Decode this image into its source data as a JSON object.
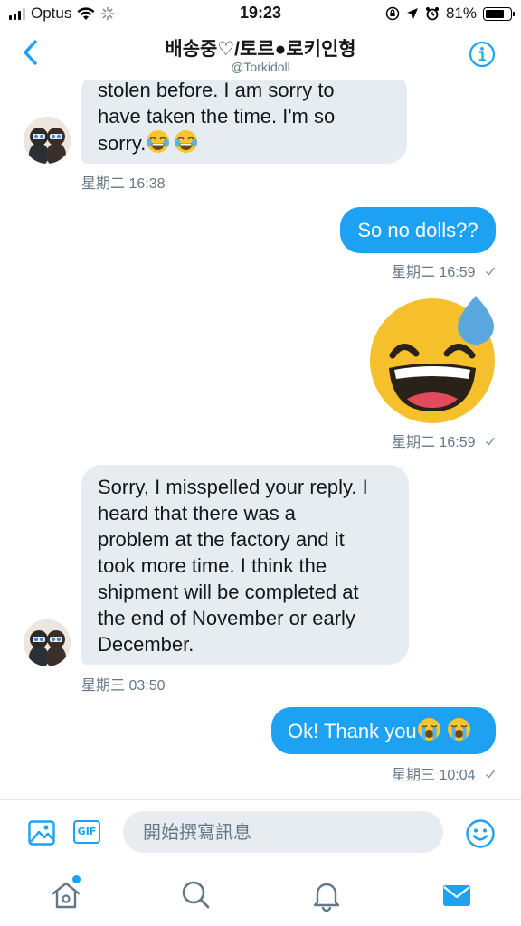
{
  "status_bar": {
    "carrier": "Optus",
    "time": "19:23",
    "battery_percent": "81%",
    "battery_level": 0.81,
    "icons": [
      "signal-icon",
      "wifi-icon",
      "loading-icon",
      "rotation-lock-icon",
      "location-icon",
      "alarm-icon",
      "battery-icon"
    ]
  },
  "header": {
    "title": "배송중♡/토르●로키인형",
    "handle": "@Torkidoll",
    "back_icon": "chevron-left-icon",
    "info_icon": "info-icon"
  },
  "conversation": {
    "contact_avatar_icon": "doll-avatar",
    "messages": [
      {
        "direction": "received",
        "text": "stolen before. I am sorry to have taken the time. I'm so sorry.",
        "emoji": [
          "face-with-tears-of-joy",
          "face-with-tears-of-joy"
        ],
        "timestamp": "星期二 16:38"
      },
      {
        "direction": "sent",
        "text": "So no dolls??",
        "timestamp": "星期二 16:59",
        "status_icon": "check-icon"
      },
      {
        "direction": "sent",
        "emoji_only": "grinning-face-with-sweat",
        "timestamp": "星期二 16:59",
        "status_icon": "check-icon"
      },
      {
        "direction": "received",
        "text": "Sorry, I misspelled your reply. I heard that there was a problem at the factory and it took more time. I think the shipment will be completed at the end of November or early December.",
        "timestamp": "星期三 03:50"
      },
      {
        "direction": "sent",
        "text": "Ok! Thank you",
        "emoji": [
          "loudly-crying-face",
          "loudly-crying-face"
        ],
        "timestamp": "星期三 10:04",
        "status_icon": "check-icon"
      }
    ],
    "lines": {
      "m1": [
        "stolen before. I am sorry to",
        "have taken the time. I'm so",
        "sorry."
      ],
      "m4": [
        "Sorry, I misspelled your reply. I",
        "heard that there was a",
        "problem at the factory and it",
        "took more time. I think the",
        "shipment will be completed at",
        "the end of November or early",
        "December."
      ],
      "m5": "Ok! Thank you"
    }
  },
  "composer": {
    "placeholder": "開始撰寫訊息",
    "value": "",
    "image_icon": "image-icon",
    "gif_label": "GIF",
    "emoji_icon": "smiley-icon"
  },
  "tab_bar": {
    "tabs": [
      "home-icon",
      "search-icon",
      "notifications-icon",
      "messages-icon"
    ],
    "active_tab": "messages-icon",
    "accent_color": "#1da1f2",
    "inactive_color": "#657786"
  },
  "colors": {
    "sent_bubble": "#1da1f2",
    "received_bubble": "#e6ecf0",
    "meta_text": "#657786"
  }
}
